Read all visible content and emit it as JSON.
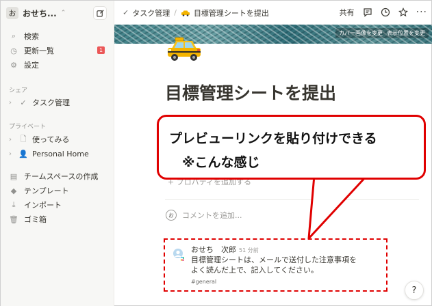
{
  "workspace": {
    "avatar_letter": "お",
    "name": "おせち..."
  },
  "sidebar": {
    "nav": [
      {
        "label": "検索",
        "icon": "search-icon"
      },
      {
        "label": "更新一覧",
        "icon": "clock-icon",
        "badge": "1"
      },
      {
        "label": "設定",
        "icon": "gear-icon"
      }
    ],
    "shared_label": "シェア",
    "shared_items": [
      {
        "label": "タスク管理",
        "icon": "check-icon"
      }
    ],
    "private_label": "プライベート",
    "private_items": [
      {
        "label": "使ってみる",
        "icon": "document-icon"
      },
      {
        "label": "Personal Home",
        "icon": "person-icon"
      }
    ],
    "bottom_items": [
      {
        "label": "チームスペースの作成",
        "icon": "team-icon"
      },
      {
        "label": "テンプレート",
        "icon": "template-icon"
      },
      {
        "label": "インポート",
        "icon": "import-icon"
      },
      {
        "label": "ゴミ箱",
        "icon": "trash-icon"
      }
    ]
  },
  "topbar": {
    "crumb1": "タスク管理",
    "crumb_sep": "/",
    "crumb2": "目標管理シートを提出",
    "share_label": "共有"
  },
  "cover": {
    "change_label": "カバー画像を変更",
    "reposition_label": "表示位置を変更"
  },
  "page": {
    "title": "目標管理シートを提出",
    "add_property": "+ プロパティを追加する",
    "add_comment": "コメントを追加..."
  },
  "preview": {
    "author": "おせち　次郎",
    "time": "51 分前",
    "body_line1": "目標管理シートは、メールで送付した注意事項を",
    "body_line2": "よく読んだ上で、記入してください。",
    "channel": "#general"
  },
  "callout": {
    "line1": "プレビューリンクを貼り付けできる",
    "line2": "※こんな感じ"
  },
  "help_label": "?",
  "colors": {
    "accent_red": "#e00000",
    "sidebar_bg": "#f7f7f5",
    "badge_red": "#eb5757"
  }
}
